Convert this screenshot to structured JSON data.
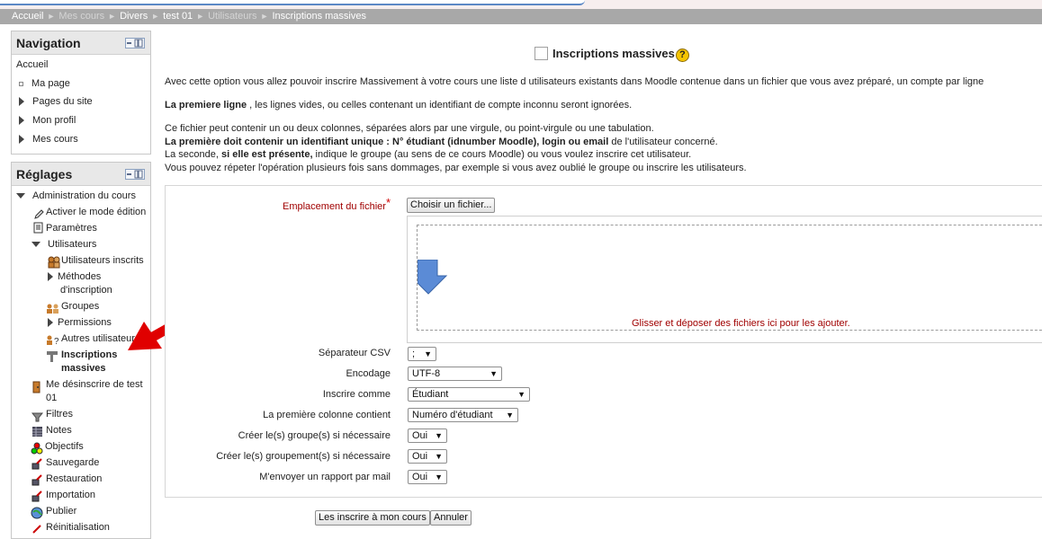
{
  "breadcrumb": {
    "items": [
      {
        "label": "Accueil",
        "dim": false
      },
      {
        "label": "Mes cours",
        "dim": true
      },
      {
        "label": "Divers",
        "dim": false
      },
      {
        "label": "test 01",
        "dim": false
      },
      {
        "label": "Utilisateurs",
        "dim": true
      },
      {
        "label": "Inscriptions massives",
        "dim": false
      }
    ],
    "separator": "►"
  },
  "navigation": {
    "title": "Navigation",
    "home": "Accueil",
    "items": {
      "my_page": "Ma page",
      "site_pages": "Pages du site",
      "profile": "Mon profil",
      "my_courses": "Mes cours"
    }
  },
  "settings": {
    "title": "Réglages",
    "course_admin": "Administration du cours",
    "edit_mode": "Activer le mode édition",
    "params": "Paramètres",
    "users": "Utilisateurs",
    "enrolled_users": "Utilisateurs inscrits",
    "enrol_methods_1": "Méthodes",
    "enrol_methods_2": "d'inscription",
    "groups": "Groupes",
    "permissions": "Permissions",
    "other_users": "Autres utilisateurs",
    "bulk_enrol_1": "Inscriptions",
    "bulk_enrol_2": "massives",
    "unenrol_1": "Me désinscrire de test",
    "unenrol_2": "01",
    "filters": "Filtres",
    "grades": "Notes",
    "outcomes": "Objectifs",
    "backup": "Sauvegarde",
    "restore": "Restauration",
    "import": "Importation",
    "publish": "Publier",
    "reset": "Réinitialisation"
  },
  "main": {
    "title": "Inscriptions massives",
    "help": "?",
    "intro": "Avec cette option vous allez pouvoir inscrire Massivement à votre cours une liste d utilisateurs existants dans Moodle contenue dans un fichier que vous avez préparé, un compte par ligne",
    "first_line_bold": "La premiere ligne",
    "first_line_rest": " , les lignes vides, ou celles contenant un identifiant de compte inconnu seront ignorées.",
    "p3_line1": "Ce fichier peut contenir un ou deux colonnes, séparées alors par une virgule, ou point-virgule ou une tabulation.",
    "p3_line2_bold": "La première doit contenir un identifiant unique : N° étudiant (idnumber Moodle), login ou email",
    "p3_line2_rest": " de l'utilisateur concerné.",
    "p3_line3_a": "La seconde, ",
    "p3_line3_bold": "si elle est présente,",
    "p3_line3_b": " indique le groupe (au sens de ce cours Moodle) ou vous voulez inscrire cet utilisateur.",
    "p3_line4": "Vous pouvez répeter l'opération plusieurs fois sans dommages, par exemple si vous avez oublié le groupe ou inscrire les utilisateurs."
  },
  "form": {
    "file_label": "Emplacement du fichier",
    "required_mark": "*",
    "choose_file": "Choisir un fichier...",
    "drop_text": "Glisser et déposer des fichiers ici pour les ajouter.",
    "csv_sep_label": "Séparateur CSV",
    "csv_sep_value": ";",
    "encoding_label": "Encodage",
    "encoding_value": "UTF-8",
    "enrol_as_label": "Inscrire comme",
    "enrol_as_value": "Étudiant",
    "first_col_label": "La première colonne contient",
    "first_col_value": "Numéro d'étudiant",
    "create_groups_label": "Créer le(s) groupe(s) si nécessaire",
    "create_groups_value": "Oui",
    "create_groupings_label": "Créer le(s) groupement(s) si nécessaire",
    "create_groupings_value": "Oui",
    "mail_report_label": "M'envoyer un rapport par mail",
    "mail_report_value": "Oui",
    "submit": "Les inscrire à mon cours",
    "cancel": "Annuler",
    "dropdown_arrow": "▼"
  },
  "colors": {
    "breadcrumb_bg": "#a8a8a8",
    "required_red": "#a00000",
    "annotation_red": "#e00000"
  }
}
